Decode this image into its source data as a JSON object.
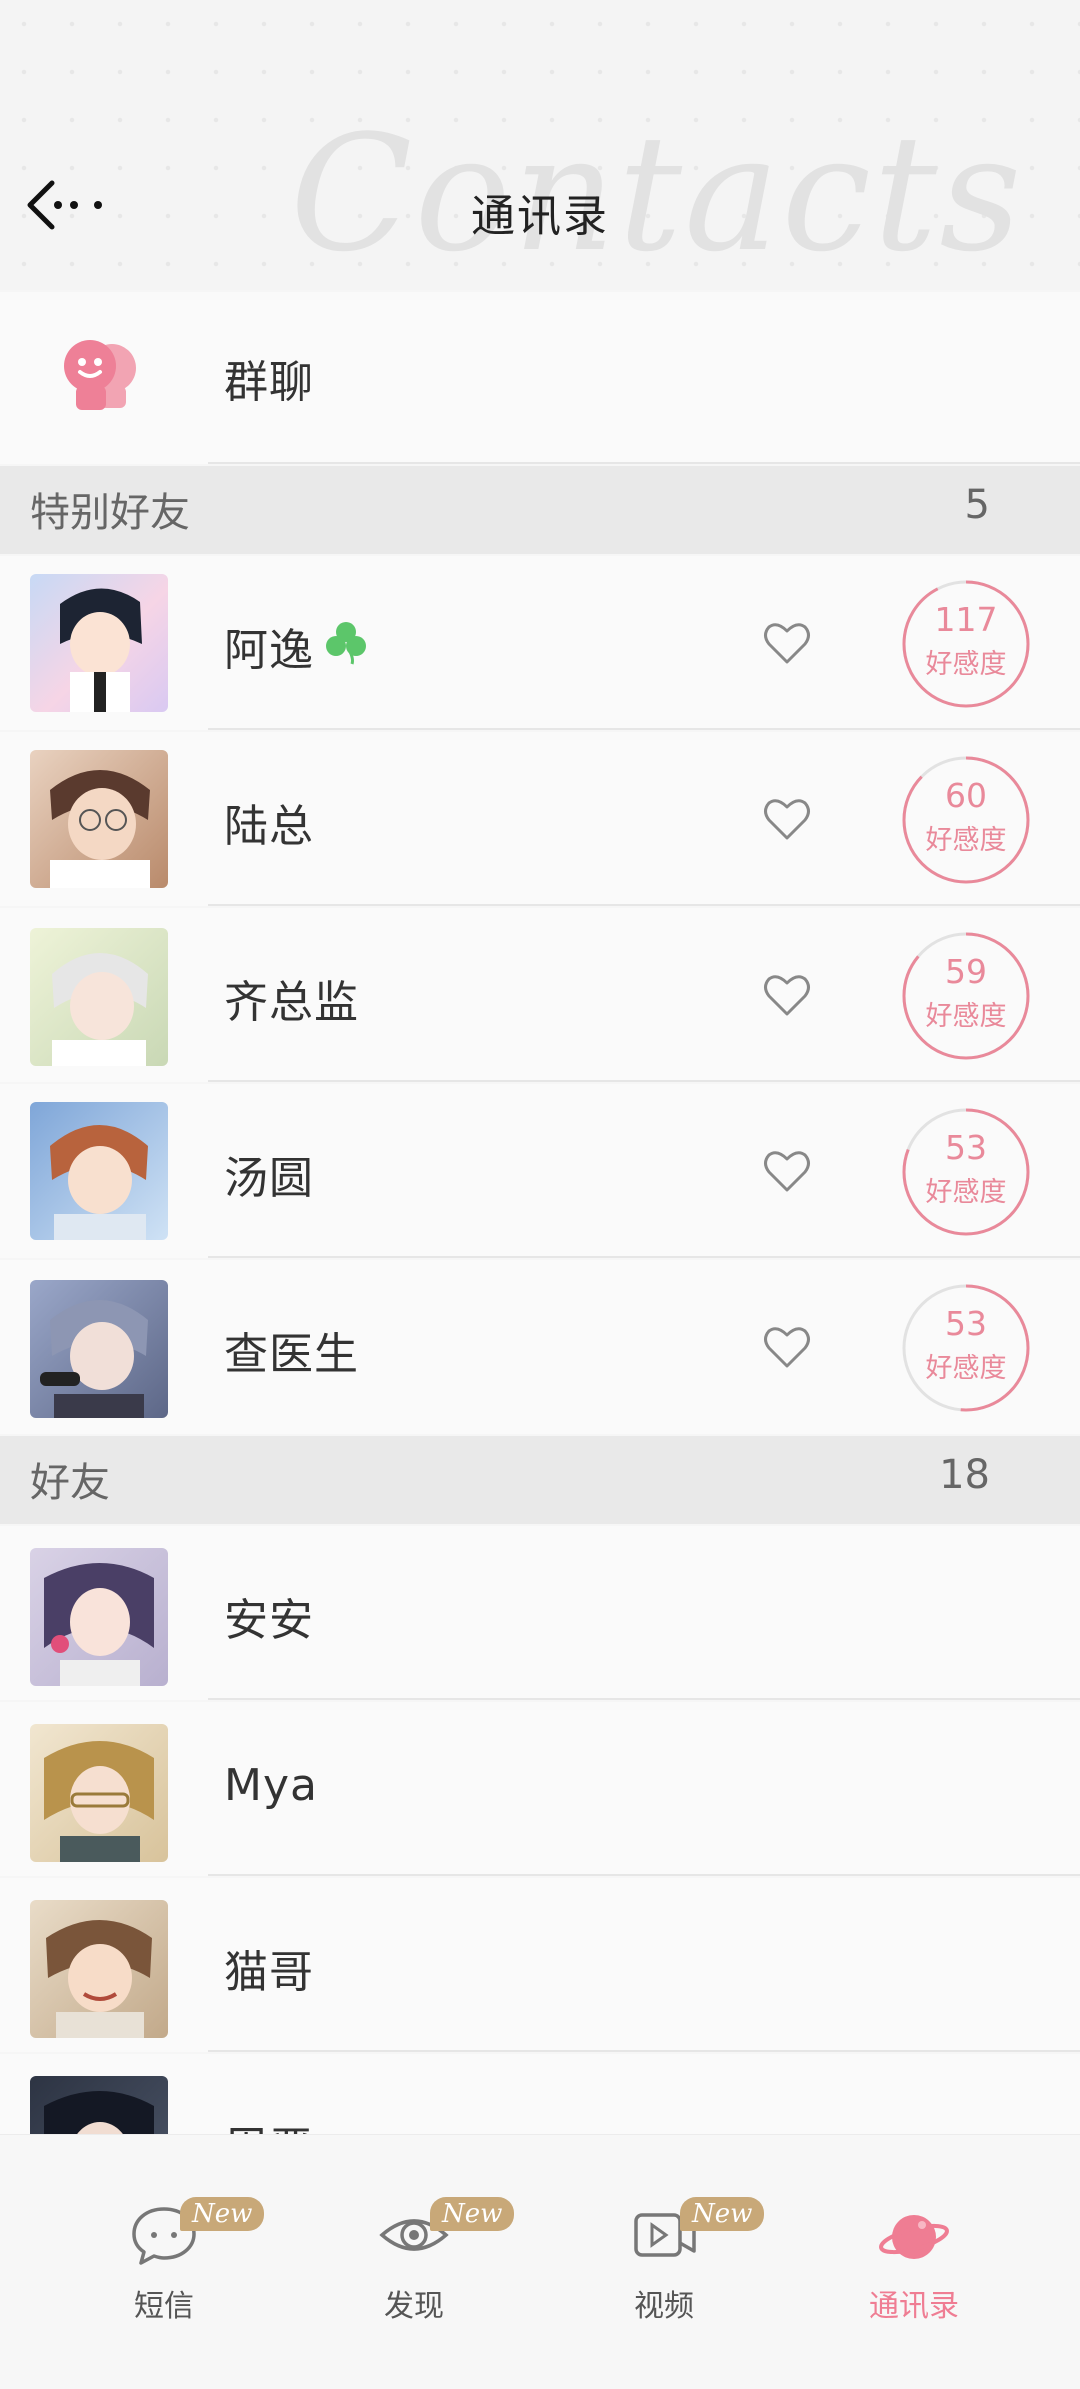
{
  "header": {
    "title": "通讯录",
    "watermark": "Contacts"
  },
  "group_chat": {
    "label": "群聊"
  },
  "special_friends": {
    "title": "特别好友",
    "count": "5",
    "items": [
      {
        "name": "阿逸",
        "affinity": "117",
        "affinity_label": "好感度",
        "clover": true
      },
      {
        "name": "陆总",
        "affinity": "60",
        "affinity_label": "好感度"
      },
      {
        "name": "齐总监",
        "affinity": "59",
        "affinity_label": "好感度"
      },
      {
        "name": "汤圆",
        "affinity": "53",
        "affinity_label": "好感度"
      },
      {
        "name": "查医生",
        "affinity": "53",
        "affinity_label": "好感度"
      }
    ]
  },
  "friends": {
    "title": "好友",
    "count": "18",
    "items": [
      {
        "name": "安安"
      },
      {
        "name": "Mya"
      },
      {
        "name": "猫哥"
      },
      {
        "name": "周严"
      }
    ]
  },
  "tabbar": {
    "tabs": [
      {
        "label": "短信",
        "badge": "New",
        "icon": "message-icon"
      },
      {
        "label": "发现",
        "badge": "New",
        "icon": "eye-icon"
      },
      {
        "label": "视频",
        "badge": "New",
        "icon": "video-icon"
      },
      {
        "label": "通讯录",
        "icon": "planet-icon",
        "active": true
      }
    ]
  },
  "colors": {
    "accent": "#ef7d93",
    "ring": "#e9899a",
    "badge": "#c8a878"
  }
}
